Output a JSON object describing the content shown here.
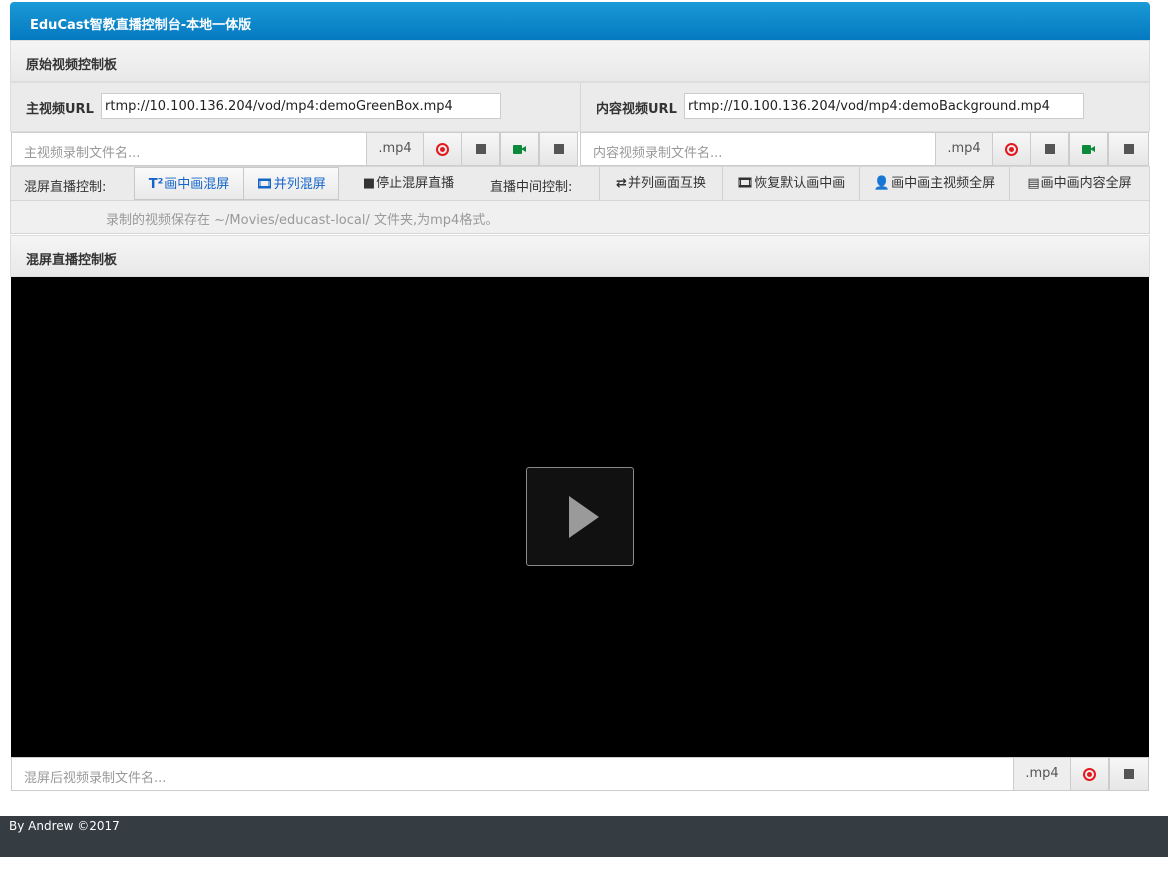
{
  "app_title": "EduCast智教直播控制台-本地一体版",
  "source_panel": {
    "title": "原始视频控制板",
    "main_url_label": "主视频URL",
    "main_url_value": "rtmp://10.100.136.204/vod/mp4:demoGreenBox.mp4",
    "content_url_label": "内容视频URL",
    "content_url_value": "rtmp://10.100.136.204/vod/mp4:demoBackground.mp4",
    "main_record_placeholder": "主视频录制文件名...",
    "content_record_placeholder": "内容视频录制文件名...",
    "ext": ".mp4"
  },
  "mix_controls": {
    "label": "混屏直播控制:",
    "pip_mix": "画中画混屏",
    "side_mix": "并列混屏",
    "stop_mix": "停止混屏直播",
    "live_label": "直播中间控制:",
    "swap": "并列画面互换",
    "restore_pip": "恢复默认画中画",
    "pip_main_full": "画中画主视频全屏",
    "pip_content_full": "画中画内容全屏"
  },
  "info_text": "录制的视频保存在 ~/Movies/educast-local/ 文件夹,为mp4格式。",
  "mix_panel": {
    "title": "混屏直播控制板",
    "record_placeholder": "混屏后视频录制文件名...",
    "ext": ".mp4"
  },
  "footer": "By Andrew ©2017",
  "colors": {
    "title_bar": "#0579c1",
    "record": "#e4191f",
    "camera": "#0c8a3c",
    "footer": "#353c42"
  },
  "icons": [
    "record-icon",
    "stop-icon",
    "camera-icon",
    "superscript-icon",
    "film-icon",
    "retweet-icon",
    "user-icon",
    "comment-icon",
    "play-icon"
  ]
}
